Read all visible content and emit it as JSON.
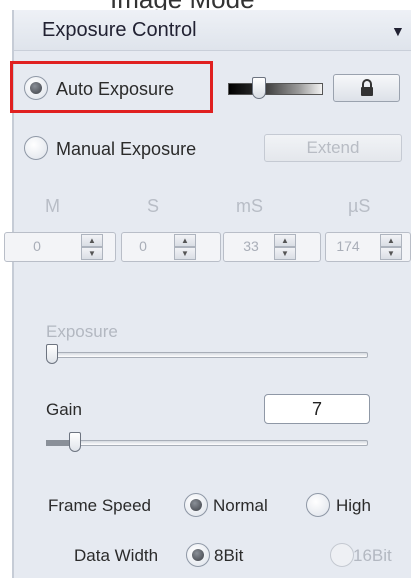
{
  "cut_title": "Image Mode",
  "panel": {
    "title": "Exposure Control",
    "collapse_icon": "triangle-down-icon"
  },
  "auto_exposure": {
    "label": "Auto Exposure",
    "selected": true,
    "level": 0.33,
    "lock_icon": "lock-icon"
  },
  "manual_exposure": {
    "label": "Manual Exposure",
    "selected": false,
    "extend_label": "Extend"
  },
  "time": {
    "headers": [
      "M",
      "S",
      "mS",
      "µS"
    ],
    "values": [
      "0",
      "0",
      "33",
      "174"
    ]
  },
  "exposure": {
    "label": "Exposure",
    "level": 0.0
  },
  "gain": {
    "label": "Gain",
    "value": "7",
    "level": 0.07
  },
  "frame_speed": {
    "label": "Frame Speed",
    "options": [
      "Normal",
      "High"
    ],
    "selected": "Normal"
  },
  "data_width": {
    "label": "Data Width",
    "options": [
      "8Bit",
      "16Bit"
    ],
    "selected": "8Bit"
  }
}
